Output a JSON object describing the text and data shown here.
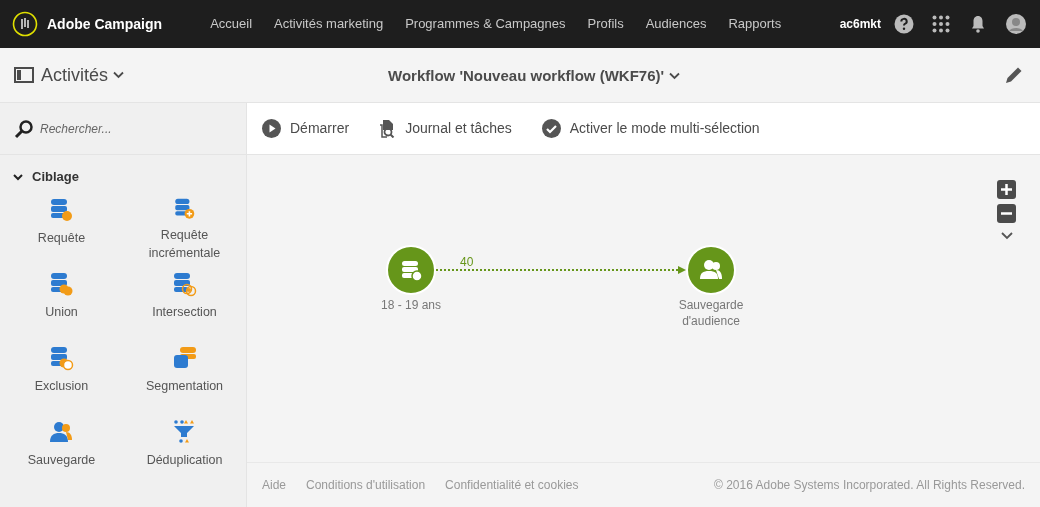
{
  "app": {
    "name": "Adobe Campaign"
  },
  "nav": [
    {
      "label": "Accueil",
      "selected": false
    },
    {
      "label": "Activités marketing",
      "selected": false
    },
    {
      "label": "Programmes & Campagnes",
      "selected": false
    },
    {
      "label": "Profils",
      "selected": false
    },
    {
      "label": "Audiences",
      "selected": false
    },
    {
      "label": "Rapports",
      "selected": false
    }
  ],
  "user": "ac6mkt",
  "header": {
    "panel": "Activités",
    "title": "Workflow 'Nouveau workflow (WKF76)'"
  },
  "search": {
    "placeholder": "Rechercher..."
  },
  "palette": {
    "section": "Ciblage",
    "expanded": true,
    "items": [
      {
        "label": "Requête",
        "kind": "query"
      },
      {
        "label": "Requête incrémentale",
        "kind": "incremental"
      },
      {
        "label": "Union",
        "kind": "union"
      },
      {
        "label": "Intersection",
        "kind": "intersection"
      },
      {
        "label": "Exclusion",
        "kind": "exclusion"
      },
      {
        "label": "Segmentation",
        "kind": "segmentation"
      },
      {
        "label": "Sauvegarde",
        "kind": "audience"
      },
      {
        "label": "Déduplication",
        "kind": "dedup"
      }
    ]
  },
  "toolbar": [
    {
      "label": "Démarrer",
      "kind": "play"
    },
    {
      "label": "Journal et tâches",
      "kind": "log"
    },
    {
      "label": "Activer le mode multi-sélection",
      "kind": "check"
    }
  ],
  "workflow": {
    "nodes": [
      {
        "label": "18 - 19 ans",
        "kind": "query"
      },
      {
        "label": "Sauvegarde d'audience",
        "kind": "audience"
      }
    ],
    "transitions": [
      {
        "label": "40"
      }
    ]
  },
  "footer": {
    "links": [
      "Aide",
      "Conditions d'utilisation",
      "Confidentialité et cookies"
    ],
    "copyright": "© 2016 Adobe Systems Incorporated. All Rights Reserved."
  }
}
